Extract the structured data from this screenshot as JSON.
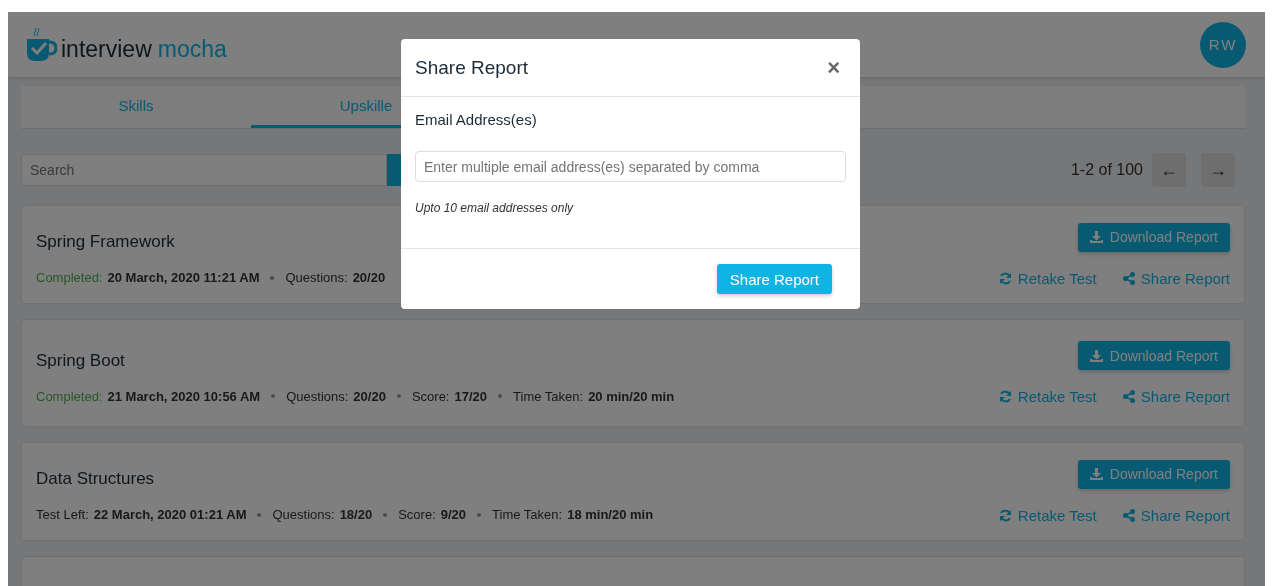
{
  "header": {
    "logo_words": [
      "interview",
      "mocha"
    ],
    "avatar": "RW"
  },
  "tabs": [
    {
      "label": "Skills",
      "selected": false
    },
    {
      "label": "Upskille",
      "selected": true
    }
  ],
  "search": {
    "placeholder": "Search"
  },
  "pagination": {
    "range": "1-2 of 100",
    "prev": "←",
    "next": "→"
  },
  "cards": [
    {
      "title": "Spring Framework",
      "meta": [
        {
          "kind": "completed",
          "label": "Completed:",
          "value": "20 March, 2020 11:21 AM"
        },
        {
          "kind": "plain",
          "label": "Questions:",
          "value": "20/20"
        }
      ],
      "download": "Download Report",
      "retake": "Retake Test",
      "share": "Share Report"
    },
    {
      "title": "Spring Boot",
      "meta": [
        {
          "kind": "completed",
          "label": "Completed:",
          "value": "21 March, 2020 10:56 AM"
        },
        {
          "kind": "plain",
          "label": "Questions:",
          "value": "20/20"
        },
        {
          "kind": "plain",
          "label": "Score:",
          "value": "17/20"
        },
        {
          "kind": "plain",
          "label": "Time Taken:",
          "value": "20 min/20 min"
        }
      ],
      "download": "Download Report",
      "retake": "Retake Test",
      "share": "Share Report"
    },
    {
      "title": "Data Structures",
      "meta": [
        {
          "kind": "plain",
          "label": "Test Left:",
          "value": "22 March, 2020 01:21 AM"
        },
        {
          "kind": "plain",
          "label": "Questions:",
          "value": "18/20"
        },
        {
          "kind": "plain",
          "label": "Score:",
          "value": "9/20"
        },
        {
          "kind": "plain",
          "label": "Time Taken:",
          "value": "18 min/20 min"
        }
      ],
      "download": "Download Report",
      "retake": "Retake Test",
      "share": "Share Report"
    }
  ],
  "modal": {
    "title": "Share Report",
    "close": "×",
    "label": "Email Address(es)",
    "placeholder": "Enter multiple email address(es) separated by comma",
    "hint": "Upto 10 email addresses only",
    "button": "Share Report"
  }
}
